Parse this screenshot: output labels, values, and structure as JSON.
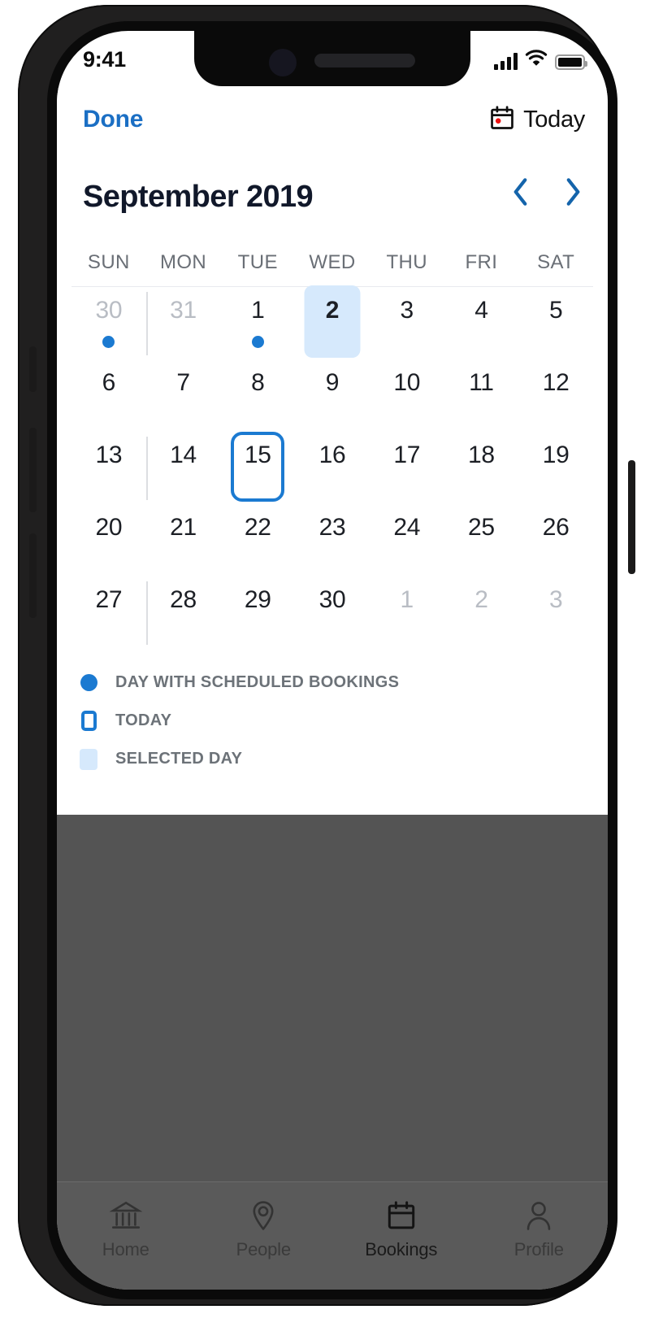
{
  "status_bar": {
    "time": "9:41",
    "signal_icon": "cellular-signal-icon",
    "wifi_icon": "wifi-icon",
    "battery_icon": "battery-full-icon"
  },
  "nav_bar": {
    "done_label": "Done",
    "today_label": "Today",
    "today_icon": "calendar-today-icon",
    "done_color": "#1b6fc4"
  },
  "calendar": {
    "month_title": "September 2019",
    "prev_icon": "chevron-left-icon",
    "next_icon": "chevron-right-icon",
    "accent_color": "#1b7ad1",
    "selected_bg_color": "#d6e9fc",
    "weekdays": [
      "SUN",
      "MON",
      "TUE",
      "WED",
      "THU",
      "FRI",
      "SAT"
    ],
    "weeks": [
      {
        "separator": true,
        "days": [
          {
            "label": "30",
            "other_month": true,
            "dot": true,
            "selected": false,
            "today": false
          },
          {
            "label": "31",
            "other_month": true,
            "dot": false,
            "selected": false,
            "today": false
          },
          {
            "label": "1",
            "other_month": false,
            "dot": true,
            "selected": false,
            "today": false
          },
          {
            "label": "2",
            "other_month": false,
            "dot": false,
            "selected": true,
            "today": false
          },
          {
            "label": "3",
            "other_month": false,
            "dot": false,
            "selected": false,
            "today": false
          },
          {
            "label": "4",
            "other_month": false,
            "dot": false,
            "selected": false,
            "today": false
          },
          {
            "label": "5",
            "other_month": false,
            "dot": false,
            "selected": false,
            "today": false
          }
        ]
      },
      {
        "separator": false,
        "days": [
          {
            "label": "6",
            "other_month": false,
            "dot": false,
            "selected": false,
            "today": false
          },
          {
            "label": "7",
            "other_month": false,
            "dot": false,
            "selected": false,
            "today": false
          },
          {
            "label": "8",
            "other_month": false,
            "dot": false,
            "selected": false,
            "today": false
          },
          {
            "label": "9",
            "other_month": false,
            "dot": false,
            "selected": false,
            "today": false
          },
          {
            "label": "10",
            "other_month": false,
            "dot": false,
            "selected": false,
            "today": false
          },
          {
            "label": "11",
            "other_month": false,
            "dot": false,
            "selected": false,
            "today": false
          },
          {
            "label": "12",
            "other_month": false,
            "dot": false,
            "selected": false,
            "today": false
          }
        ]
      },
      {
        "separator": true,
        "days": [
          {
            "label": "13",
            "other_month": false,
            "dot": false,
            "selected": false,
            "today": false
          },
          {
            "label": "14",
            "other_month": false,
            "dot": false,
            "selected": false,
            "today": false
          },
          {
            "label": "15",
            "other_month": false,
            "dot": false,
            "selected": false,
            "today": true
          },
          {
            "label": "16",
            "other_month": false,
            "dot": false,
            "selected": false,
            "today": false
          },
          {
            "label": "17",
            "other_month": false,
            "dot": false,
            "selected": false,
            "today": false
          },
          {
            "label": "18",
            "other_month": false,
            "dot": false,
            "selected": false,
            "today": false
          },
          {
            "label": "19",
            "other_month": false,
            "dot": false,
            "selected": false,
            "today": false
          }
        ]
      },
      {
        "separator": false,
        "days": [
          {
            "label": "20",
            "other_month": false,
            "dot": false,
            "selected": false,
            "today": false
          },
          {
            "label": "21",
            "other_month": false,
            "dot": false,
            "selected": false,
            "today": false
          },
          {
            "label": "22",
            "other_month": false,
            "dot": false,
            "selected": false,
            "today": false
          },
          {
            "label": "23",
            "other_month": false,
            "dot": false,
            "selected": false,
            "today": false
          },
          {
            "label": "24",
            "other_month": false,
            "dot": false,
            "selected": false,
            "today": false
          },
          {
            "label": "25",
            "other_month": false,
            "dot": false,
            "selected": false,
            "today": false
          },
          {
            "label": "26",
            "other_month": false,
            "dot": false,
            "selected": false,
            "today": false
          }
        ]
      },
      {
        "separator": true,
        "days": [
          {
            "label": "27",
            "other_month": false,
            "dot": false,
            "selected": false,
            "today": false
          },
          {
            "label": "28",
            "other_month": false,
            "dot": false,
            "selected": false,
            "today": false
          },
          {
            "label": "29",
            "other_month": false,
            "dot": false,
            "selected": false,
            "today": false
          },
          {
            "label": "30",
            "other_month": false,
            "dot": false,
            "selected": false,
            "today": false
          },
          {
            "label": "1",
            "other_month": true,
            "dot": false,
            "selected": false,
            "today": false
          },
          {
            "label": "2",
            "other_month": true,
            "dot": false,
            "selected": false,
            "today": false
          },
          {
            "label": "3",
            "other_month": true,
            "dot": false,
            "selected": false,
            "today": false
          }
        ]
      }
    ]
  },
  "legend": [
    {
      "label": "DAY WITH SCHEDULED BOOKINGS",
      "swatch": "dot"
    },
    {
      "label": "TODAY",
      "swatch": "today"
    },
    {
      "label": "SELECTED DAY",
      "swatch": "selected"
    }
  ],
  "tab_bar": [
    {
      "label": "Home",
      "icon": "bank-icon",
      "active": false
    },
    {
      "label": "People",
      "icon": "location-pin-icon",
      "active": false
    },
    {
      "label": "Bookings",
      "icon": "calendar-icon",
      "active": true
    },
    {
      "label": "Profile",
      "icon": "person-icon",
      "active": false
    }
  ]
}
